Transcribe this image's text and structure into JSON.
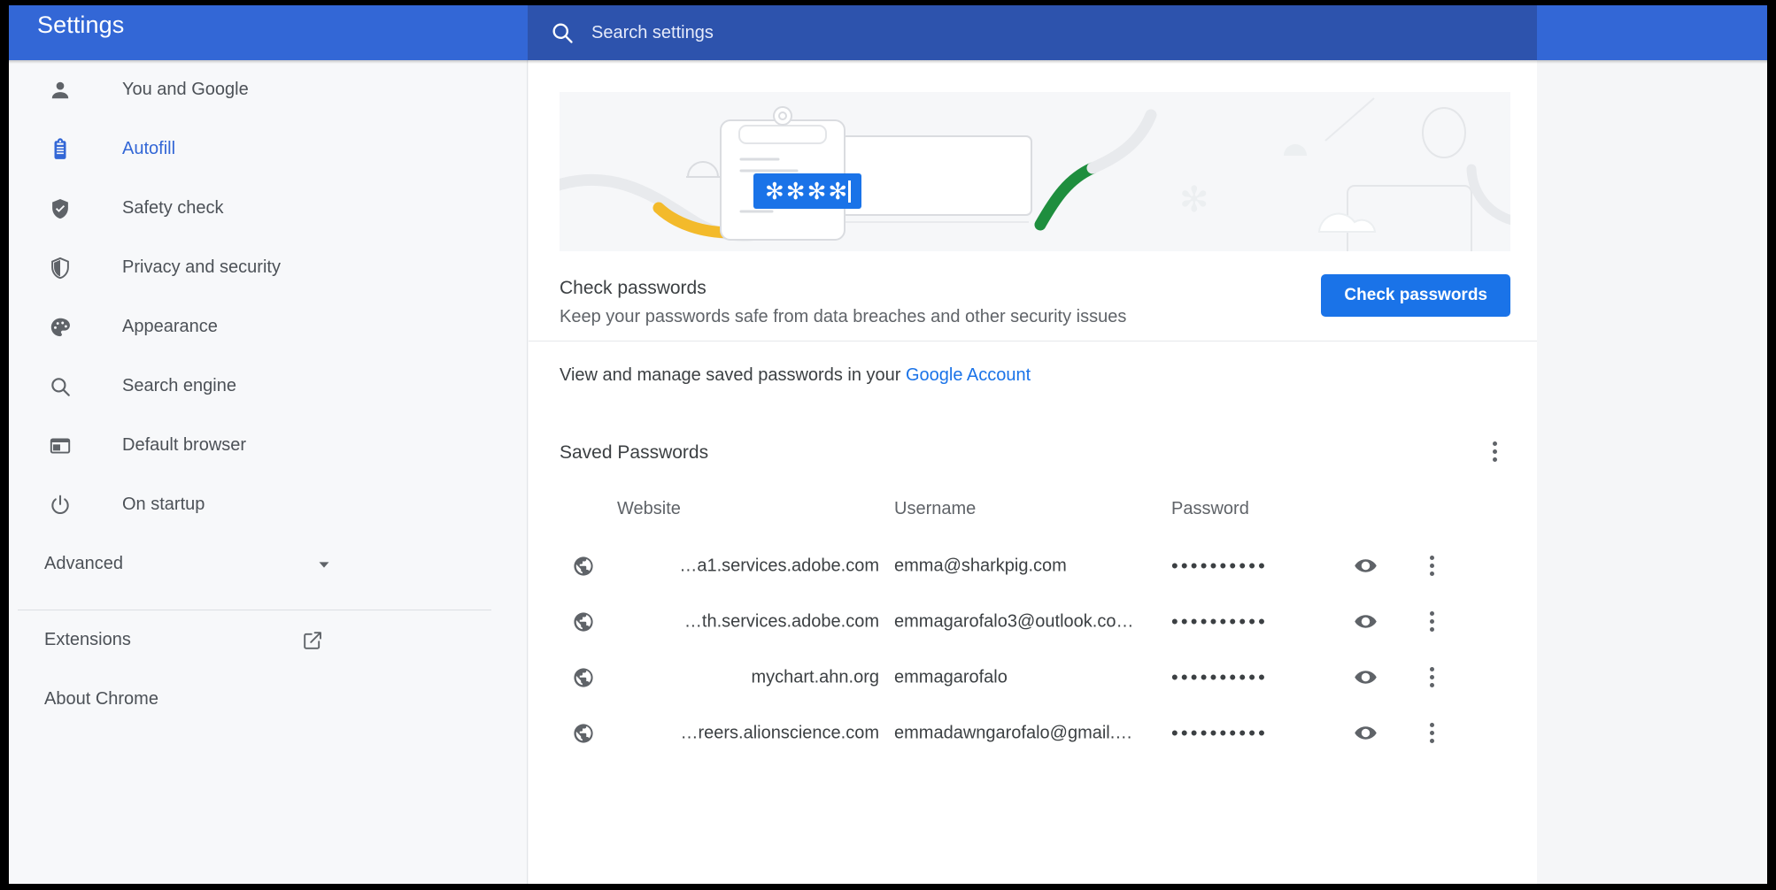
{
  "window": {
    "title": "Settings",
    "accent_color": "#3367d6",
    "search_bar_color": "#2d53ad",
    "link_color": "#1a73e8",
    "button_color": "#1a73e8"
  },
  "search": {
    "placeholder": "Search settings",
    "value": "",
    "icon": "search-icon"
  },
  "sidebar": {
    "items": [
      {
        "label": "You and Google",
        "icon": "person-icon",
        "active": false
      },
      {
        "label": "Autofill",
        "icon": "clipboard-icon",
        "active": true
      },
      {
        "label": "Safety check",
        "icon": "shield-check-icon",
        "active": false
      },
      {
        "label": "Privacy and security",
        "icon": "shield-half-icon",
        "active": false
      },
      {
        "label": "Appearance",
        "icon": "palette-icon",
        "active": false
      },
      {
        "label": "Search engine",
        "icon": "search-icon",
        "active": false
      },
      {
        "label": "Default browser",
        "icon": "browser-window-icon",
        "active": false
      },
      {
        "label": "On startup",
        "icon": "power-icon",
        "active": false
      }
    ],
    "advanced": {
      "label": "Advanced",
      "icon": "chevron-down-icon"
    },
    "footer_items": [
      {
        "label": "Extensions",
        "icon": "external-link-icon"
      },
      {
        "label": "About Chrome",
        "icon": ""
      }
    ]
  },
  "main": {
    "banner": {
      "icon": "password-illustration"
    },
    "check_passwords": {
      "title": "Check passwords",
      "subtitle": "Keep your passwords safe from data breaches and other security issues",
      "button_label": "Check passwords"
    },
    "manage": {
      "text_before": "View and manage saved passwords in your ",
      "link_label": "Google Account"
    },
    "saved_passwords": {
      "title": "Saved Passwords",
      "more_icon": "kebab-menu-icon",
      "columns": [
        "Website",
        "Username",
        "Password"
      ],
      "rows": [
        {
          "website": "…a1.services.adobe.com",
          "username": "emma@sharkpig.com",
          "password_mask": "••••••••••",
          "show_icon": "eye-icon",
          "more_icon": "kebab-menu-icon",
          "site_icon": "globe-icon"
        },
        {
          "website": "…th.services.adobe.com",
          "username": "emmagarofalo3@outlook.co…",
          "password_mask": "••••••••••",
          "show_icon": "eye-icon",
          "more_icon": "kebab-menu-icon",
          "site_icon": "globe-icon"
        },
        {
          "website": "mychart.ahn.org",
          "username": "emmagarofalo",
          "password_mask": "••••••••••",
          "show_icon": "eye-icon",
          "more_icon": "kebab-menu-icon",
          "site_icon": "globe-icon"
        },
        {
          "website": "…reers.alionscience.com",
          "username": "emmadawngarofalo@gmail.…",
          "password_mask": "••••••••••",
          "show_icon": "eye-icon",
          "more_icon": "kebab-menu-icon",
          "site_icon": "globe-icon"
        }
      ]
    }
  }
}
